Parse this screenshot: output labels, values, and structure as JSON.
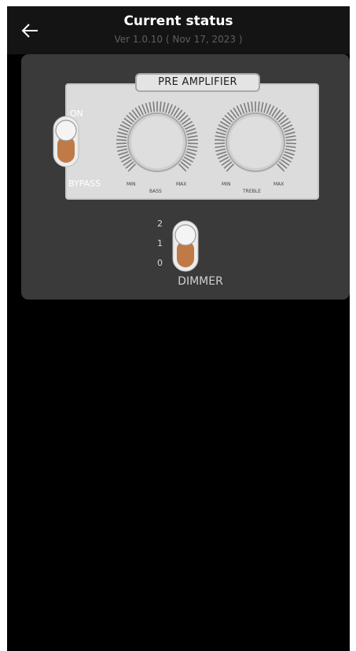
{
  "header": {
    "title": "Current status",
    "version": "Ver 1.0.10 ( Nov 17, 2023 )",
    "back_icon": "arrow-left-icon"
  },
  "preamp": {
    "label": "PRE AMPLIFIER",
    "bypass_switch": {
      "on_label": "ON",
      "bypass_label": "BYPASS",
      "state": "ON"
    },
    "bass": {
      "label": "BASS",
      "min_label": "MIN",
      "max_label": "MAX"
    },
    "treble": {
      "label": "TREBLE",
      "min_label": "MIN",
      "max_label": "MAX"
    }
  },
  "dimmer": {
    "label": "DIMMER",
    "levels": [
      "2",
      "1",
      "0"
    ],
    "selected": "2"
  },
  "colors": {
    "background": "#000000",
    "header": "#141414",
    "card": "#3a3a3a",
    "panel": "#dcdcdc",
    "toggle_fill": "#c07a45"
  }
}
